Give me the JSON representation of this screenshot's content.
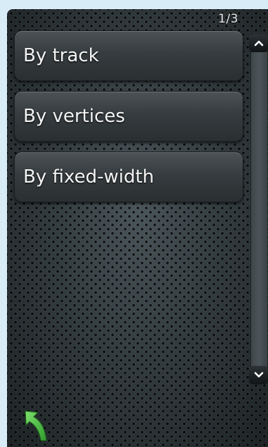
{
  "page_indicator": "1/3",
  "menu": {
    "items": [
      {
        "label": "By track"
      },
      {
        "label": "By vertices"
      },
      {
        "label": "By fixed-width"
      }
    ]
  },
  "icons": {
    "scroll_up": "chevron-up-icon",
    "scroll_down": "chevron-down-icon",
    "back": "back-arrow-icon"
  },
  "colors": {
    "frame_background": "#d8ecf8",
    "back_arrow": "#4fc64a"
  }
}
